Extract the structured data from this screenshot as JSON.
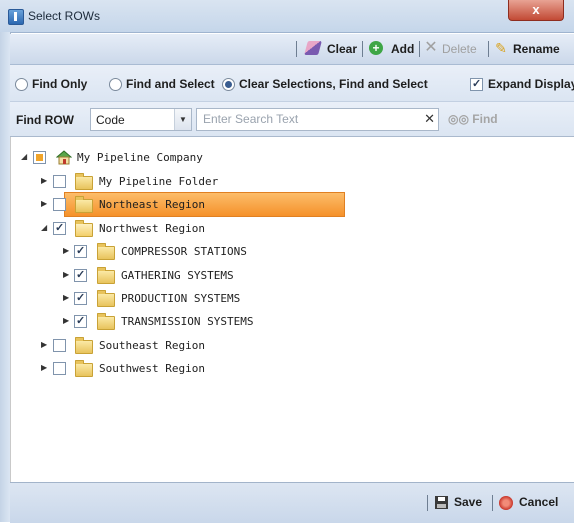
{
  "window": {
    "title": "Select ROWs",
    "close_label": "x"
  },
  "toolbar": {
    "clear_label": "Clear",
    "add_label": "Add",
    "delete_label": "Delete",
    "rename_label": "Rename"
  },
  "options": {
    "find_only": "Find Only",
    "find_and_select": "Find and Select",
    "clear_find_select": "Clear Selections, Find and Select",
    "selected_mode": "clear_find_select",
    "expand_display_label": "Expand Display",
    "expand_display_checked": true
  },
  "find": {
    "label": "Find ROW",
    "field_value": "Code",
    "search_placeholder": "Enter Search Text",
    "find_button": "Find"
  },
  "tree": {
    "root": {
      "label": "My Pipeline Company",
      "state": "partial",
      "expanded": true
    },
    "items": [
      {
        "label": "My Pipeline Folder",
        "state": "unchecked",
        "expanded": false,
        "selected": false
      },
      {
        "label": "Northeast Region",
        "state": "unchecked",
        "expanded": false,
        "selected": true
      },
      {
        "label": "Northwest Region",
        "state": "checked",
        "expanded": true,
        "selected": false
      },
      {
        "label": "COMPRESSOR STATIONS",
        "state": "checked",
        "expanded": false,
        "selected": false
      },
      {
        "label": "GATHERING SYSTEMS",
        "state": "checked",
        "expanded": false,
        "selected": false
      },
      {
        "label": "PRODUCTION SYSTEMS",
        "state": "checked",
        "expanded": false,
        "selected": false
      },
      {
        "label": "TRANSMISSION SYSTEMS",
        "state": "checked",
        "expanded": false,
        "selected": false
      },
      {
        "label": "Southeast Region",
        "state": "unchecked",
        "expanded": false,
        "selected": false
      },
      {
        "label": "Southwest Region",
        "state": "unchecked",
        "expanded": false,
        "selected": false
      }
    ]
  },
  "footer": {
    "save_label": "Save",
    "cancel_label": "Cancel"
  },
  "colors": {
    "selection": "#f5912a",
    "titlebar": "#c5d6ea",
    "close": "#c24a35"
  }
}
